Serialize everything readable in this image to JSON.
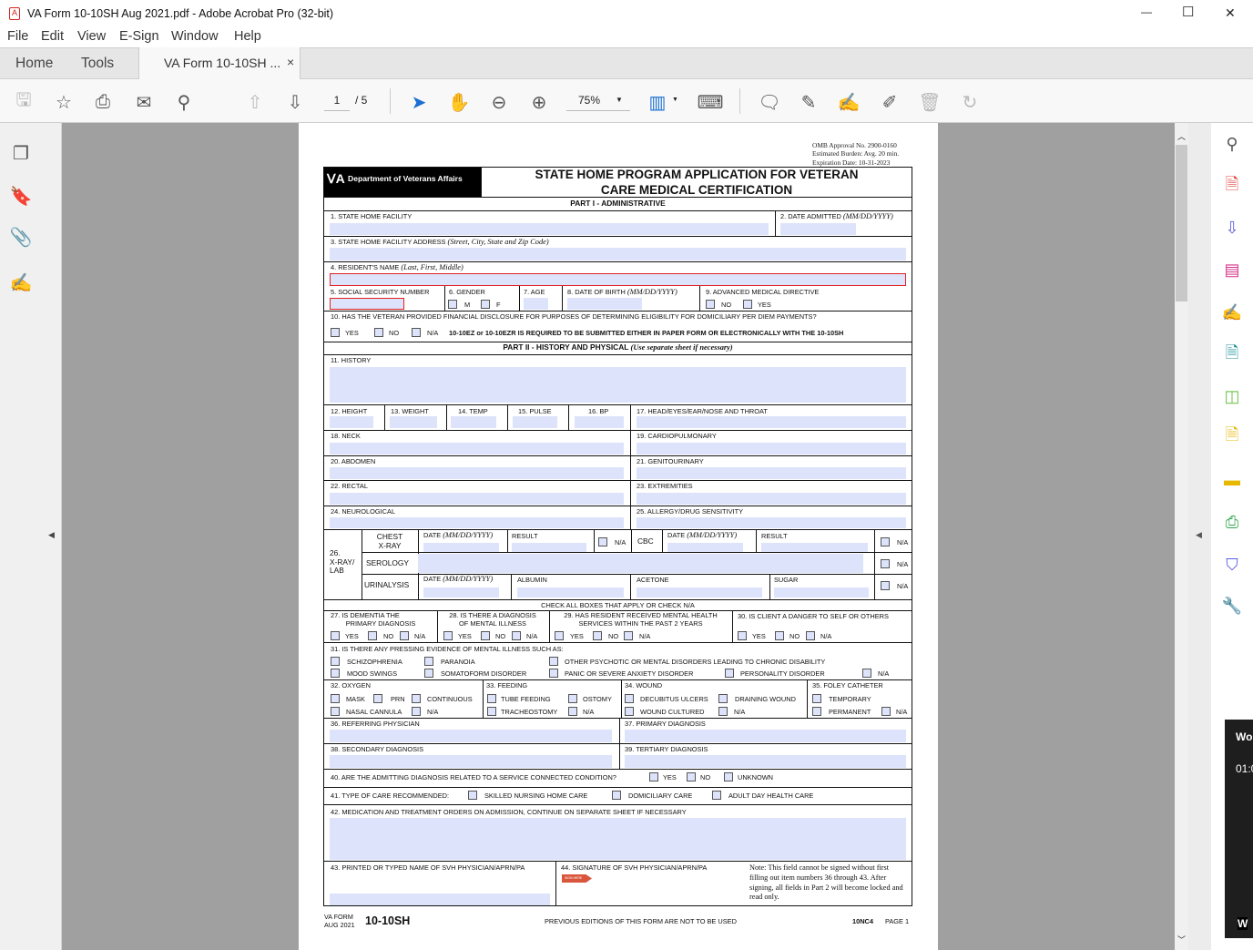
{
  "window": {
    "title": "VA Form 10-10SH Aug 2021.pdf - Adobe Acrobat Pro (32-bit)",
    "minimize": "—",
    "maximize": "☐",
    "close": "✕"
  },
  "menu": [
    "File",
    "Edit",
    "View",
    "E-Sign",
    "Window",
    "Help"
  ],
  "tabs": {
    "home": "Home",
    "tools": "Tools",
    "doc": "VA Form 10-10SH ...",
    "doc_close": "×"
  },
  "toolbar": {
    "page_current": "1",
    "page_total": "/ 5",
    "zoom": "75%"
  },
  "overlay": {
    "line1": "Wo",
    "line2": "01:0",
    "line3": "W"
  },
  "form": {
    "omb": [
      "OMB Approval No. 2900-0160",
      "Estimated Burden:  Avg. 20 min.",
      "Expiration Date: 10-31-2023"
    ],
    "agency": "Department of Veterans Affairs",
    "title1": "STATE HOME PROGRAM APPLICATION FOR VETERAN",
    "title2": "CARE MEDICAL CERTIFICATION",
    "part1": "PART I - ADMINISTRATIVE",
    "f1": "1. STATE HOME FACILITY",
    "f2": "2. DATE ADMITTED ",
    "f2i": "(MM/DD/YYYY)",
    "f3": "3. STATE HOME FACILITY ADDRESS ",
    "f3i": "(Street, City, State and Zip Code)",
    "f4": "4. RESIDENT'S NAME ",
    "f4i": "(Last, First, Middle)",
    "f5": "5. SOCIAL SECURITY NUMBER",
    "f6": "6. GENDER",
    "m": "M",
    "fe": "F",
    "f7": "7. AGE",
    "f8": "8. DATE OF BIRTH ",
    "f8i": "(MM/DD/YYYY)",
    "f9": "9. ADVANCED MEDICAL DIRECTIVE",
    "yes": "YES",
    "no": "NO",
    "na": "N/A",
    "f10": "10. HAS THE VETERAN PROVIDED FINANCIAL DISCLOSURE FOR PURPOSES OF DETERMINING ELIGIBILITY FOR DOMICILIARY PER DIEM PAYMENTS?",
    "f10note": "10-10EZ or 10-10EZR IS REQUIRED TO BE SUBMITTED EITHER IN PAPER FORM OR ELECTRONICALLY WITH THE 10-10SH",
    "part2": "PART II - HISTORY AND PHYSICAL ",
    "part2i": "(Use separate sheet if necessary)",
    "f11": "11. HISTORY",
    "f12": "12. HEIGHT",
    "f13": "13. WEIGHT",
    "f14": "14. TEMP",
    "f15": "15. PULSE",
    "f16": "16. BP",
    "f17": "17. HEAD/EYES/EAR/NOSE AND THROAT",
    "f18": "18. NECK",
    "f19": "19. CARDIOPULMONARY",
    "f20": "20. ABDOMEN",
    "f21": "21. GENITOURINARY",
    "f22": "22. RECTAL",
    "f23": "23. EXTREMITIES",
    "f24": "24. NEUROLOGICAL",
    "f25": "25. ALLERGY/DRUG SENSITIVITY",
    "f26": [
      "26.",
      "X-RAY/",
      "LAB"
    ],
    "chest": [
      "CHEST",
      "X-RAY"
    ],
    "date": "DATE ",
    "datei": "(MM/DD/YYYY)",
    "result": "RESULT",
    "cbc": "CBC",
    "serology": "SEROLOGY",
    "urinalysis": "URINALYSIS",
    "albumin": "ALBUMIN",
    "acetone": "ACETONE",
    "sugar": "SUGAR",
    "checkall": "CHECK ALL BOXES THAT APPLY OR CHECK N/A",
    "f27": [
      "27. IS DEMENTIA THE",
      "PRIMARY DIAGNOSIS"
    ],
    "f28": [
      "28. IS THERE A DIAGNOSIS",
      "OF MENTAL ILLNESS"
    ],
    "f29": [
      "29. HAS RESIDENT RECEIVED MENTAL HEALTH",
      "SERVICES WITHIN THE PAST 2 YEARS"
    ],
    "f30": "30. IS CLIENT A DANGER TO SELF OR OTHERS",
    "f31": "31. IS THERE ANY PRESSING EVIDENCE OF MENTAL ILLNESS SUCH AS:",
    "schizo": "SCHIZOPHRENIA",
    "paranoia": "PARANOIA",
    "other": "OTHER PSYCHOTIC OR MENTAL DISORDERS LEADING TO CHRONIC DISABILITY",
    "mood": "MOOD SWINGS",
    "somato": "SOMATOFORM DISORDER",
    "panic": "PANIC OR SEVERE ANXIETY DISORDER",
    "personality": "PERSONALITY DISORDER",
    "f32": "32. OXYGEN",
    "mask": "MASK",
    "prn": "PRN",
    "continuous": "CONTINUOUS",
    "nasal": "NASAL CANNULA",
    "f33": "33. FEEDING",
    "tube": "TUBE FEEDING",
    "ostomy": "OSTOMY",
    "trach": "TRACHEOSTOMY",
    "f34": "34. WOUND",
    "decub": "DECUBITUS ULCERS",
    "draining": "DRAINING WOUND",
    "cultured": "WOUND CULTURED",
    "f35": "35. FOLEY CATHETER",
    "temporary": "TEMPORARY",
    "permanent": "PERMANENT",
    "f36": "36. REFERRING PHYSICIAN",
    "f37": "37. PRIMARY DIAGNOSIS",
    "f38": "38. SECONDARY DIAGNOSIS",
    "f39": "39. TERTIARY DIAGNOSIS",
    "f40": "40. ARE THE ADMITTING DIAGNOSIS RELATED TO A SERVICE CONNECTED CONDITION?",
    "unknown": "UNKNOWN",
    "f41": "41. TYPE OF CARE RECOMMENDED:",
    "skilled": "SKILLED NURSING HOME CARE",
    "domiciliary": "DOMICILIARY CARE",
    "adult": "ADULT DAY HEALTH CARE",
    "f42": "42. MEDICATION AND TREATMENT ORDERS ON ADMISSION, CONTINUE ON SEPARATE SHEET IF NECESSARY",
    "f43": "43. PRINTED OR TYPED NAME OF SVH PHYSICIAN/APRN/PA",
    "f44": "44. SIGNATURE OF SVH PHYSICIAN/APRN/PA",
    "sign_here": "SIGN HERE",
    "note": "Note: This field cannot be signed without first filling out item numbers 36 through 43. After signing, all fields in Part 2 will become locked and read only.",
    "footer": {
      "vaform": "VA FORM",
      "date": "AUG 2021",
      "number": "10-10SH",
      "previous": "PREVIOUS EDITIONS OF THIS FORM ARE NOT TO BE USED",
      "code": "10NC4",
      "page": "PAGE 1"
    }
  }
}
